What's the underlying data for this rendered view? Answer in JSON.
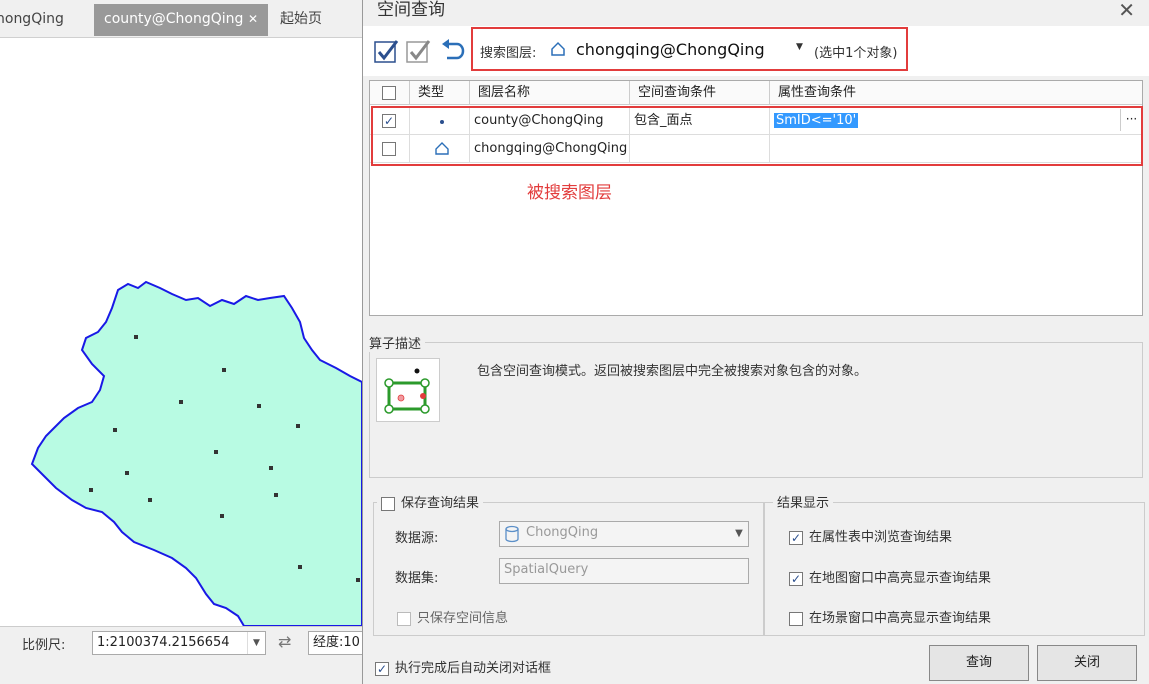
{
  "tabs": [
    {
      "label": "nongQing",
      "active": false
    },
    {
      "label": "county@ChongQing",
      "active": true
    },
    {
      "label": "起始页",
      "active": false
    }
  ],
  "tab_close_glyph": "✕",
  "statusbar": {
    "scale_label": "比例尺:",
    "scale_value": "1:2100374.2156654",
    "swap_glyph": "⇄",
    "longitude_label": "经度:10"
  },
  "dialog": {
    "title": "空间查询",
    "close_glyph": "✕",
    "search_layer_label": "搜索图层:",
    "search_layer_value": "chongqing@ChongQing",
    "selection_info": "(选中1个对象)",
    "table": {
      "headers": [
        "类型",
        "图层名称",
        "空间查询条件",
        "属性查询条件"
      ],
      "rows": [
        {
          "checked": true,
          "type_icon": "point-icon",
          "layer": "county@ChongQing",
          "spatial": "包含_面点",
          "attribute": "SmID<='10'"
        },
        {
          "checked": false,
          "type_icon": "polygon-icon",
          "layer": "chongqing@ChongQing",
          "spatial": "",
          "attribute": ""
        }
      ],
      "ellipsis": "···"
    },
    "annotation": "被搜索图层",
    "operator": {
      "group_label": "算子描述",
      "description": "包含空间查询模式。返回被搜索图层中完全被搜索对象包含的对象。"
    },
    "save": {
      "group_label": "保存查询结果",
      "checked": false,
      "datasource_label": "数据源:",
      "datasource_value": "ChongQing",
      "dataset_label": "数据集:",
      "dataset_value": "SpatialQuery",
      "spatial_only_label": "只保存空间信息"
    },
    "display": {
      "group_label": "结果显示",
      "options": [
        {
          "label": "在属性表中浏览查询结果",
          "checked": true
        },
        {
          "label": "在地图窗口中高亮显示查询结果",
          "checked": true
        },
        {
          "label": "在场景窗口中高亮显示查询结果",
          "checked": false
        }
      ]
    },
    "auto_close_label": "执行完成后自动关闭对话框",
    "auto_close_checked": true,
    "query_button": "查询",
    "close_button": "关闭"
  },
  "colors": {
    "map_fill": "#b8fbe3",
    "map_border": "#1919e6",
    "highlight_red": "#e23c3c",
    "selection_blue": "#3399ff"
  }
}
